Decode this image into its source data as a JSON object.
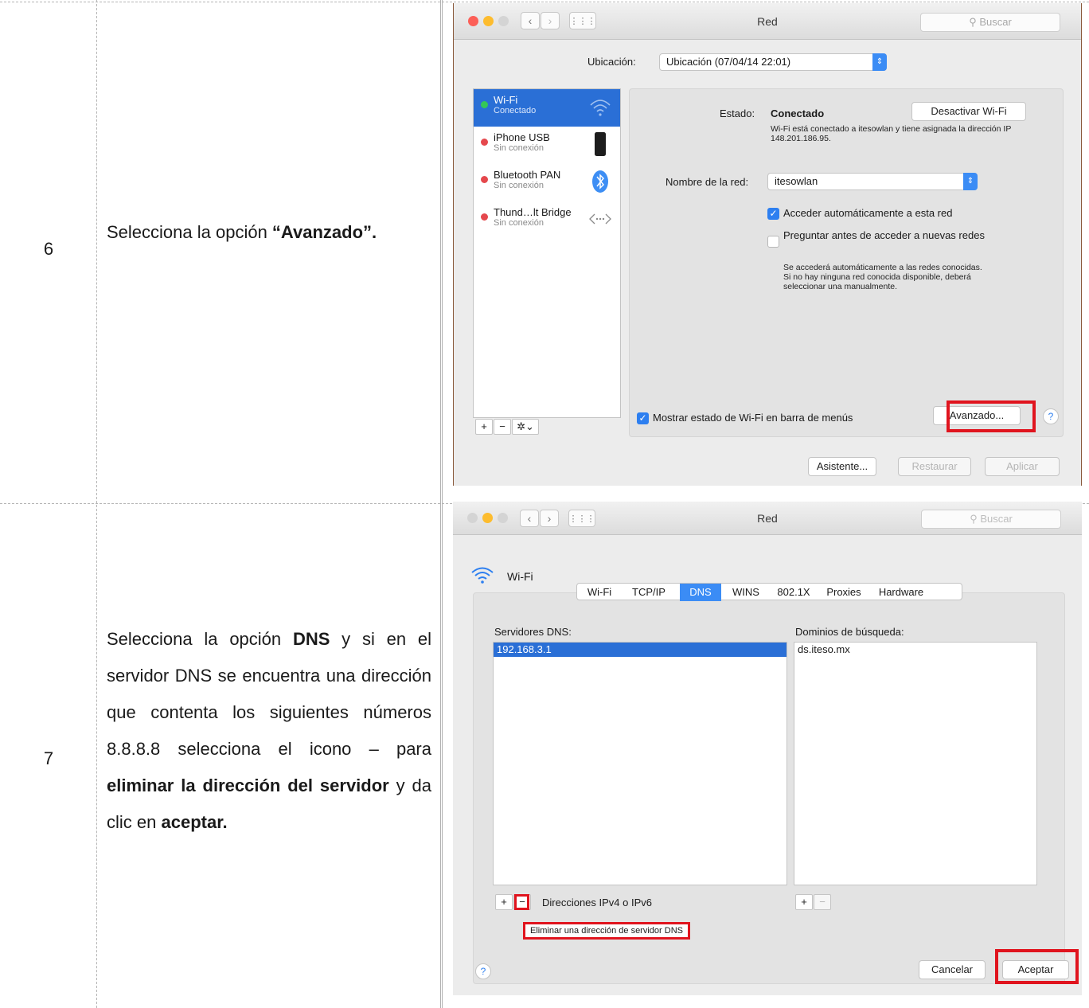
{
  "steps": [
    {
      "number": "6",
      "text_prefix": "Selecciona la opción ",
      "text_bold": "“Avanzado”."
    },
    {
      "number": "7",
      "t1": "Selecciona la opción ",
      "b1": "DNS",
      "t2": " y si en el servidor DNS se encuentra una dirección que contenta los siguientes números 8.8.8.8 selecciona el icono – para ",
      "b2": "eliminar la dirección del servidor",
      "t3": " y da clic en ",
      "b3": "aceptar."
    }
  ],
  "window1": {
    "title": "Red",
    "search_placeholder": "Buscar",
    "location_label": "Ubicación:",
    "location_value": "Ubicación (07/04/14 22:01)",
    "services": [
      {
        "name": "Wi-Fi",
        "status": "Conectado",
        "dot": "#34c759",
        "selected": true
      },
      {
        "name": "iPhone USB",
        "status": "Sin conexión",
        "dot": "#e5484d",
        "selected": false
      },
      {
        "name": "Bluetooth PAN",
        "status": "Sin conexión",
        "dot": "#e5484d",
        "selected": false
      },
      {
        "name": "Thund…lt Bridge",
        "status": "Sin conexión",
        "dot": "#e5484d",
        "selected": false
      }
    ],
    "estado_label": "Estado:",
    "estado_value": "Conectado",
    "desactivar_button": "Desactivar Wi-Fi",
    "estado_desc": "Wi-Fi está conectado a itesowlan y tiene asignada la dirección IP 148.201.186.95.",
    "network_name_label": "Nombre de la red:",
    "network_name_value": "itesowlan",
    "auto_join_label": "Acceder automáticamente a esta red",
    "ask_join_label": "Preguntar antes de acceder a nuevas redes",
    "ask_join_desc": "Se accederá automáticamente a las redes conocidas. Si no hay ninguna red conocida disponible, deberá seleccionar una manualmente.",
    "show_status_label": "Mostrar estado de Wi-Fi en barra de menús",
    "advanced_button": "Avanzado...",
    "help": "?",
    "assistant_button": "Asistente...",
    "restore_button": "Restaurar",
    "apply_button": "Aplicar"
  },
  "window2": {
    "title": "Red",
    "search_placeholder": "Buscar",
    "header": "Wi-Fi",
    "tabs": [
      "Wi-Fi",
      "TCP/IP",
      "DNS",
      "WINS",
      "802.1X",
      "Proxies",
      "Hardware"
    ],
    "active_tab": "DNS",
    "dns_servers_label": "Servidores DNS:",
    "dns_servers": [
      "192.168.3.1"
    ],
    "search_domains_label": "Dominios de búsqueda:",
    "search_domains": [
      "ds.iteso.mx"
    ],
    "address_hint": "Direcciones IPv4 o IPv6",
    "tooltip": "Eliminar una dirección de servidor DNS",
    "help": "?",
    "cancel_button": "Cancelar",
    "accept_button": "Aceptar"
  }
}
